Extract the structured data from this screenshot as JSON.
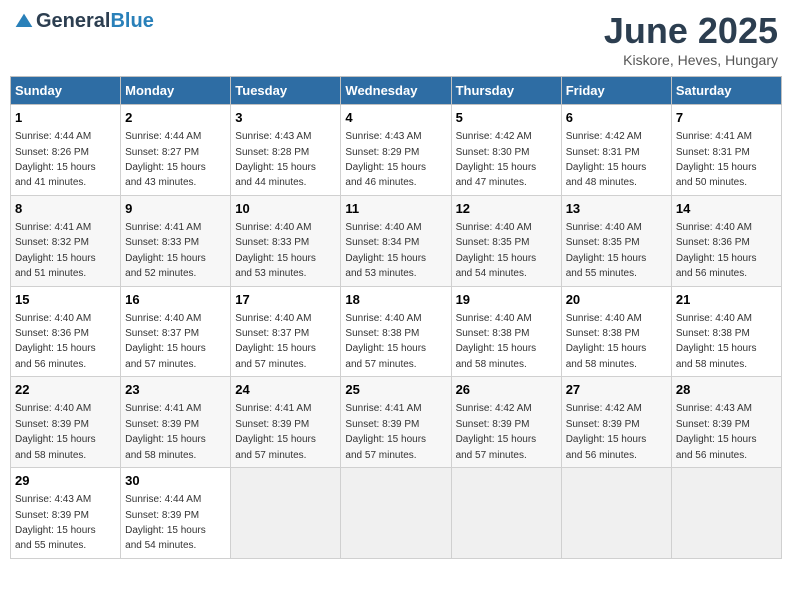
{
  "header": {
    "logo_general": "General",
    "logo_blue": "Blue",
    "title": "June 2025",
    "subtitle": "Kiskore, Heves, Hungary"
  },
  "calendar": {
    "weekdays": [
      "Sunday",
      "Monday",
      "Tuesday",
      "Wednesday",
      "Thursday",
      "Friday",
      "Saturday"
    ],
    "weeks": [
      [
        null,
        null,
        null,
        null,
        null,
        null,
        null
      ]
    ],
    "days": [
      {
        "num": "1",
        "sunrise": "4:44 AM",
        "sunset": "8:26 PM",
        "daylight": "15 hours and 41 minutes."
      },
      {
        "num": "2",
        "sunrise": "4:44 AM",
        "sunset": "8:27 PM",
        "daylight": "15 hours and 43 minutes."
      },
      {
        "num": "3",
        "sunrise": "4:43 AM",
        "sunset": "8:28 PM",
        "daylight": "15 hours and 44 minutes."
      },
      {
        "num": "4",
        "sunrise": "4:43 AM",
        "sunset": "8:29 PM",
        "daylight": "15 hours and 46 minutes."
      },
      {
        "num": "5",
        "sunrise": "4:42 AM",
        "sunset": "8:30 PM",
        "daylight": "15 hours and 47 minutes."
      },
      {
        "num": "6",
        "sunrise": "4:42 AM",
        "sunset": "8:31 PM",
        "daylight": "15 hours and 48 minutes."
      },
      {
        "num": "7",
        "sunrise": "4:41 AM",
        "sunset": "8:31 PM",
        "daylight": "15 hours and 50 minutes."
      },
      {
        "num": "8",
        "sunrise": "4:41 AM",
        "sunset": "8:32 PM",
        "daylight": "15 hours and 51 minutes."
      },
      {
        "num": "9",
        "sunrise": "4:41 AM",
        "sunset": "8:33 PM",
        "daylight": "15 hours and 52 minutes."
      },
      {
        "num": "10",
        "sunrise": "4:40 AM",
        "sunset": "8:33 PM",
        "daylight": "15 hours and 53 minutes."
      },
      {
        "num": "11",
        "sunrise": "4:40 AM",
        "sunset": "8:34 PM",
        "daylight": "15 hours and 53 minutes."
      },
      {
        "num": "12",
        "sunrise": "4:40 AM",
        "sunset": "8:35 PM",
        "daylight": "15 hours and 54 minutes."
      },
      {
        "num": "13",
        "sunrise": "4:40 AM",
        "sunset": "8:35 PM",
        "daylight": "15 hours and 55 minutes."
      },
      {
        "num": "14",
        "sunrise": "4:40 AM",
        "sunset": "8:36 PM",
        "daylight": "15 hours and 56 minutes."
      },
      {
        "num": "15",
        "sunrise": "4:40 AM",
        "sunset": "8:36 PM",
        "daylight": "15 hours and 56 minutes."
      },
      {
        "num": "16",
        "sunrise": "4:40 AM",
        "sunset": "8:37 PM",
        "daylight": "15 hours and 57 minutes."
      },
      {
        "num": "17",
        "sunrise": "4:40 AM",
        "sunset": "8:37 PM",
        "daylight": "15 hours and 57 minutes."
      },
      {
        "num": "18",
        "sunrise": "4:40 AM",
        "sunset": "8:38 PM",
        "daylight": "15 hours and 57 minutes."
      },
      {
        "num": "19",
        "sunrise": "4:40 AM",
        "sunset": "8:38 PM",
        "daylight": "15 hours and 58 minutes."
      },
      {
        "num": "20",
        "sunrise": "4:40 AM",
        "sunset": "8:38 PM",
        "daylight": "15 hours and 58 minutes."
      },
      {
        "num": "21",
        "sunrise": "4:40 AM",
        "sunset": "8:38 PM",
        "daylight": "15 hours and 58 minutes."
      },
      {
        "num": "22",
        "sunrise": "4:40 AM",
        "sunset": "8:39 PM",
        "daylight": "15 hours and 58 minutes."
      },
      {
        "num": "23",
        "sunrise": "4:41 AM",
        "sunset": "8:39 PM",
        "daylight": "15 hours and 58 minutes."
      },
      {
        "num": "24",
        "sunrise": "4:41 AM",
        "sunset": "8:39 PM",
        "daylight": "15 hours and 57 minutes."
      },
      {
        "num": "25",
        "sunrise": "4:41 AM",
        "sunset": "8:39 PM",
        "daylight": "15 hours and 57 minutes."
      },
      {
        "num": "26",
        "sunrise": "4:42 AM",
        "sunset": "8:39 PM",
        "daylight": "15 hours and 57 minutes."
      },
      {
        "num": "27",
        "sunrise": "4:42 AM",
        "sunset": "8:39 PM",
        "daylight": "15 hours and 56 minutes."
      },
      {
        "num": "28",
        "sunrise": "4:43 AM",
        "sunset": "8:39 PM",
        "daylight": "15 hours and 56 minutes."
      },
      {
        "num": "29",
        "sunrise": "4:43 AM",
        "sunset": "8:39 PM",
        "daylight": "15 hours and 55 minutes."
      },
      {
        "num": "30",
        "sunrise": "4:44 AM",
        "sunset": "8:39 PM",
        "daylight": "15 hours and 54 minutes."
      }
    ],
    "start_dow": 0,
    "labels": {
      "sunrise": "Sunrise:",
      "sunset": "Sunset:",
      "daylight": "Daylight:"
    }
  }
}
